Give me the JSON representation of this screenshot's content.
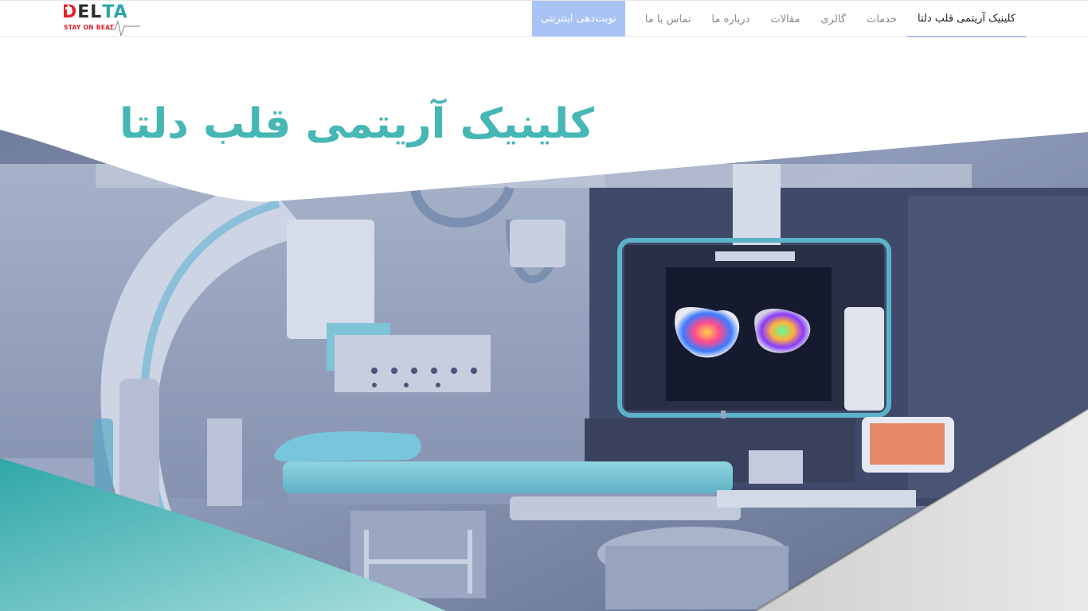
{
  "brand": {
    "name_letters": {
      "d": "D",
      "el": "EL",
      "ta": "TA"
    },
    "tagline": "STAY ON BEAT",
    "colors": {
      "red": "#e0232a",
      "teal": "#2aa7a7",
      "dark": "#2d2d2d"
    }
  },
  "nav": {
    "items": [
      {
        "label": "کلینیک آریتمی قلب دلتا",
        "active": true
      },
      {
        "label": "خدمات"
      },
      {
        "label": "گالری"
      },
      {
        "label": "مقالات"
      },
      {
        "label": "درباره ما"
      },
      {
        "label": "تماس با ما"
      }
    ],
    "cta_label": "نوبت‌دهی اینترنتی"
  },
  "hero": {
    "title": "کلینیک آریتمی قلب دلتا",
    "accent_color": "#45b7b4",
    "image_description_icon": "cath-lab-photo"
  }
}
